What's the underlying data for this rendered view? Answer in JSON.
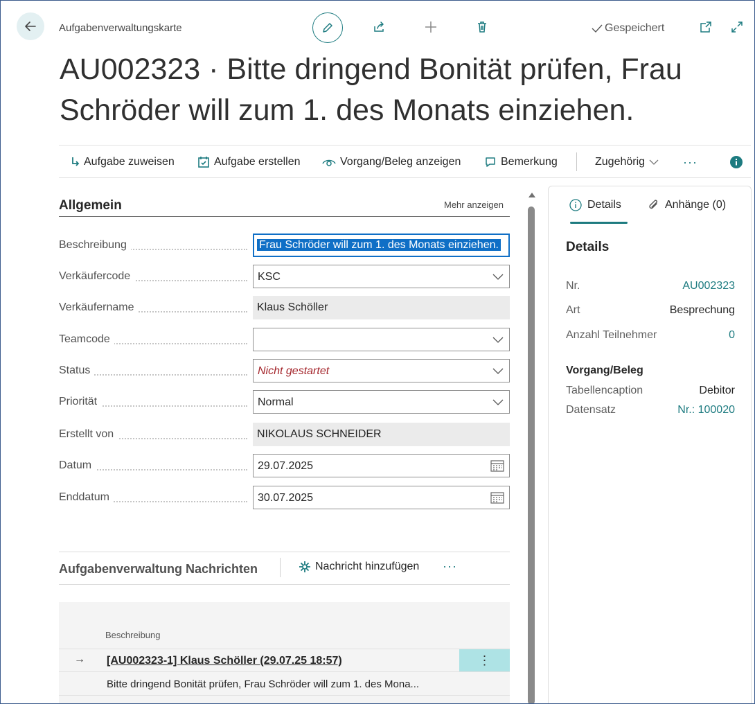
{
  "header": {
    "breadcrumb": "Aufgabenverwaltungskarte",
    "saved_label": "Gespeichert",
    "title": "AU002323 · Bitte dringend Bonität prüfen, Frau Schröder will zum 1. des Monats einziehen."
  },
  "actions": [
    {
      "label": "Aufgabe zuweisen",
      "icon": "arrow-down-right-icon"
    },
    {
      "label": "Aufgabe erstellen",
      "icon": "task-add-icon"
    },
    {
      "label": "Vorgang/Beleg anzeigen",
      "icon": "eye-icon"
    },
    {
      "label": "Bemerkung",
      "icon": "comment-icon"
    },
    {
      "label": "Zugehörig",
      "icon": "chevron-down-icon"
    }
  ],
  "general": {
    "title": "Allgemein",
    "more_label": "Mehr anzeigen",
    "fields": {
      "beschreibung": {
        "label": "Beschreibung",
        "value": "Frau Schröder will zum 1. des Monats einziehen."
      },
      "verkaeufercode": {
        "label": "Verkäufercode",
        "value": "KSC"
      },
      "verkaeufername": {
        "label": "Verkäufername",
        "value": "Klaus Schöller"
      },
      "teamcode": {
        "label": "Teamcode",
        "value": ""
      },
      "status": {
        "label": "Status",
        "value": "Nicht gestartet"
      },
      "prioritaet": {
        "label": "Priorität",
        "value": "Normal"
      },
      "erstellt_von": {
        "label": "Erstellt von",
        "value": "NIKOLAUS SCHNEIDER"
      },
      "datum": {
        "label": "Datum",
        "value": "29.07.2025"
      },
      "enddatum": {
        "label": "Enddatum",
        "value": "30.07.2025"
      }
    }
  },
  "messages": {
    "title": "Aufgabenverwaltung Nachrichten",
    "add_label": "Nachricht hinzufügen",
    "column_header": "Beschreibung",
    "rows": [
      {
        "text": "[AU002323-1] Klaus Schöller (29.07.25 18:57)"
      },
      {
        "text": "Bitte dringend Bonität prüfen, Frau Schröder will zum 1. des Mona..."
      }
    ]
  },
  "factbox": {
    "tabs": [
      {
        "label": "Details",
        "icon": "info-icon"
      },
      {
        "label": "Anhänge (0)",
        "icon": "paperclip-icon"
      }
    ],
    "title": "Details",
    "rows": [
      {
        "key": "Nr.",
        "value": "AU002323"
      },
      {
        "key": "Art",
        "value": "Besprechung"
      },
      {
        "key": "Anzahl Teilnehmer",
        "value": "0"
      }
    ],
    "subsection": "Vorgang/Beleg",
    "subrows": [
      {
        "key": "Tabellencaption",
        "value": "Debitor"
      },
      {
        "key": "Datensatz",
        "value": "Nr.: 100020"
      }
    ]
  },
  "colors": {
    "accent": "#1d7b80",
    "selection": "#0f6fc6",
    "status_text": "#a4262c"
  }
}
